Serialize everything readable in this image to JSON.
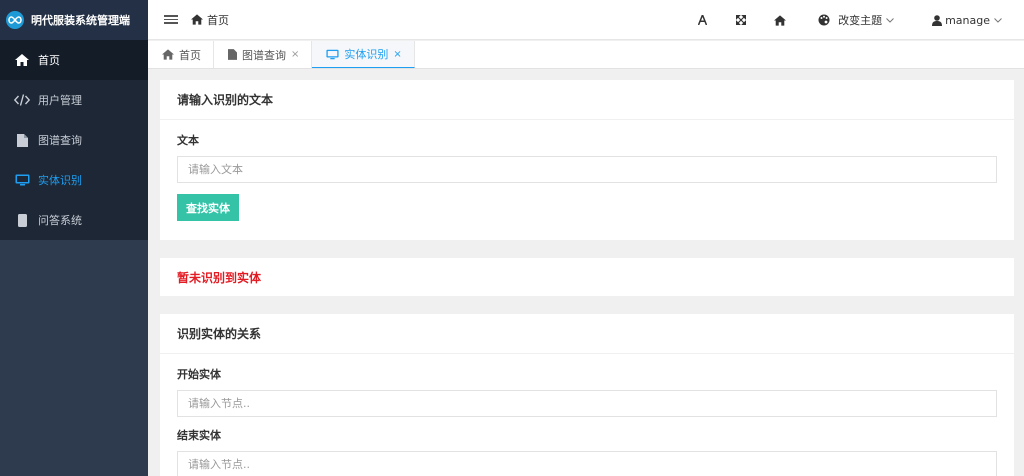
{
  "app": {
    "title": "明代服装系统管理端"
  },
  "sidebar": {
    "items": [
      {
        "label": "首页",
        "icon": "home-icon"
      },
      {
        "label": "用户管理",
        "icon": "code-icon"
      },
      {
        "label": "图谱查询",
        "icon": "file-icon"
      },
      {
        "label": "实体识别",
        "icon": "monitor-icon"
      },
      {
        "label": "问答系统",
        "icon": "mobile-icon"
      }
    ],
    "active_index": 3,
    "colors": {
      "bg": "#2e3a4d",
      "menu_bg": "#1d2735",
      "active": "#1e9ff2"
    }
  },
  "header": {
    "breadcrumb": "首页",
    "theme_label": "改变主题",
    "user_label": "manage",
    "icons": [
      "font-icon",
      "fullscreen-icon",
      "home-icon",
      "palette-icon",
      "user-icon"
    ]
  },
  "tabs": [
    {
      "label": "首页",
      "closable": false
    },
    {
      "label": "图谱查询",
      "closable": true
    },
    {
      "label": "实体识别",
      "closable": true,
      "active": true
    }
  ],
  "close_glyph": "×",
  "entity_card": {
    "title": "请输入识别的文本",
    "field_label": "文本",
    "placeholder": "请输入文本",
    "value": "",
    "button_label": "查找实体"
  },
  "result": {
    "message": "暂未识别到实体",
    "color": "#e31b23"
  },
  "relation_card": {
    "title": "识别实体的关系",
    "start_label": "开始实体",
    "start_placeholder": "请输入节点..",
    "end_label": "结束实体",
    "end_placeholder": "请输入节点.."
  },
  "accent_colors": {
    "primary_button": "#35c3a8",
    "link": "#1e9ff2"
  }
}
